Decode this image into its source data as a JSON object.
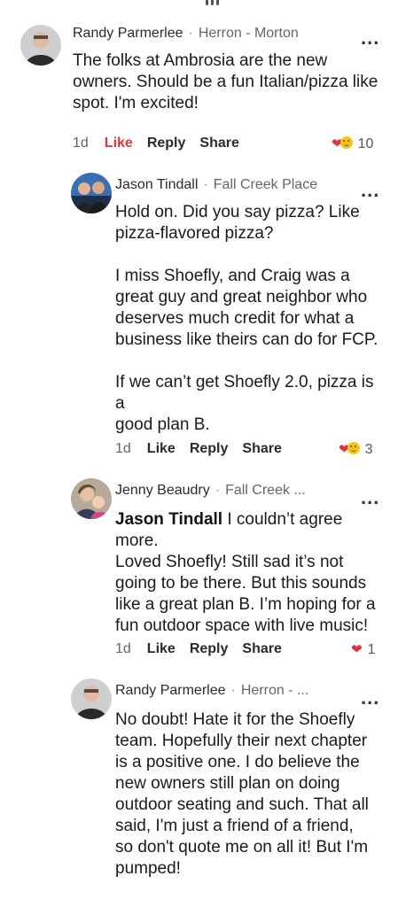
{
  "comments": [
    {
      "author": "Randy Parmerlee",
      "location": "Herron - Morton",
      "lines": [
        "The folks at Ambrosia are the new",
        "owners. Should be a fun Italian/pizza like",
        "spot. I'm excited!"
      ],
      "age": "1d",
      "like": "Like",
      "reply": "Reply",
      "share": "Share",
      "reaction_count": "10"
    },
    {
      "author": "Jason Tindall",
      "location": "Fall Creek Place",
      "paragraphs": [
        [
          "Hold on. Did you say pizza? Like",
          "pizza-flavored pizza?"
        ],
        [
          "I miss Shoefly, and Craig was a",
          "great guy and great neighbor who",
          "deserves much credit for what a",
          "business like theirs can do for FCP."
        ],
        [
          "If we can’t get Shoefly 2.0, pizza is a",
          "good plan B."
        ]
      ],
      "age": "1d",
      "like": "Like",
      "reply": "Reply",
      "share": "Share",
      "reaction_count": "3"
    },
    {
      "author": "Jenny Beaudry",
      "location": "Fall Creek ...",
      "mention": "Jason Tindall",
      "first_line_rest": " I couldn’t agree more.",
      "lines": [
        "Loved Shoefly!  Still sad it’s not",
        "going to be there. But this sounds",
        "like a great plan B. I’m hoping for a",
        "fun outdoor space with live music!"
      ],
      "age": "1d",
      "like": "Like",
      "reply": "Reply",
      "share": "Share",
      "reaction_count": "1"
    },
    {
      "author": "Randy Parmerlee",
      "location": "Herron - ...",
      "lines": [
        "No doubt! Hate it for the Shoefly",
        "team. Hopefully their next chapter",
        "is a positive one. I do believe the",
        "new owners still plan on doing",
        "outdoor seating and such. That all",
        "said, I'm just a friend of a friend,",
        "so don't quote me on all it! But I'm",
        "pumped!"
      ]
    }
  ],
  "ui": {
    "separator": "·",
    "more": "...",
    "heart_color": "#e3303b",
    "liked_color": "#e0333c"
  }
}
